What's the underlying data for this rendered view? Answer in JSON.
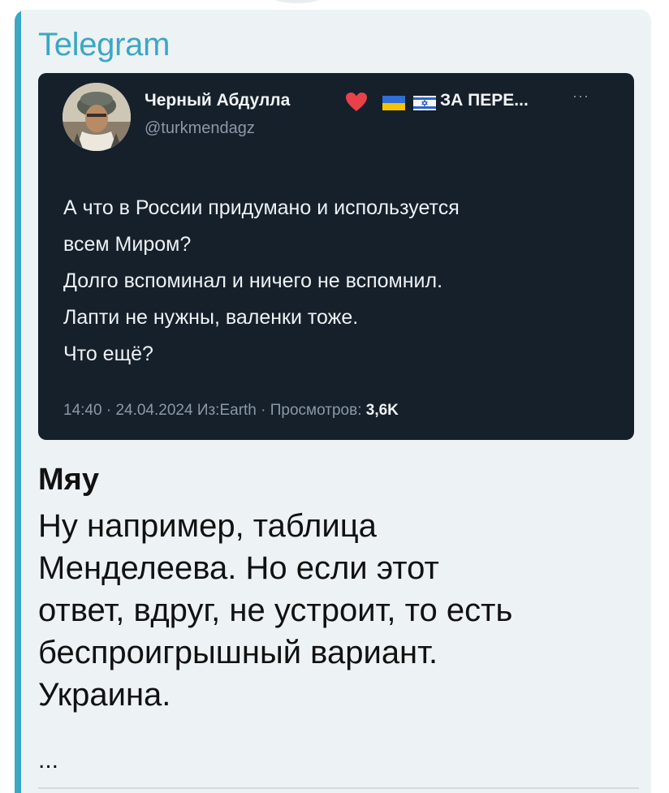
{
  "source": {
    "name": "Telegram",
    "accent_color": "#3ba7c4"
  },
  "tweet": {
    "author_name": "Черный Абдулла",
    "author_tag": "ЗА ПЕРЕ...",
    "author_badges": [
      "heart-icon",
      "ukraine-flag-icon",
      "israel-flag-icon"
    ],
    "handle": "@turkmendagz",
    "more_label": "···",
    "text_lines": [
      "А что в России придумано и используется",
      "всем Миром?",
      "Долго вспоминал и ничего не вспомнил.",
      "Лапти не нужны, валенки тоже.",
      "Что ещё?"
    ],
    "meta": {
      "time": "14:40",
      "date": "24.04.2024",
      "source": "Из:Earth",
      "views_label": "Просмотров:",
      "views_count": "3,6K"
    },
    "background_color": "#15202b"
  },
  "comment": {
    "author": "Мяу",
    "text_lines": [
      "Ну например, таблица",
      "Менделеева. Но если этот",
      "ответ, вдруг, не устроит, то есть",
      "беспроигрышный вариант.",
      "Украина."
    ],
    "ellipsis": "..."
  }
}
